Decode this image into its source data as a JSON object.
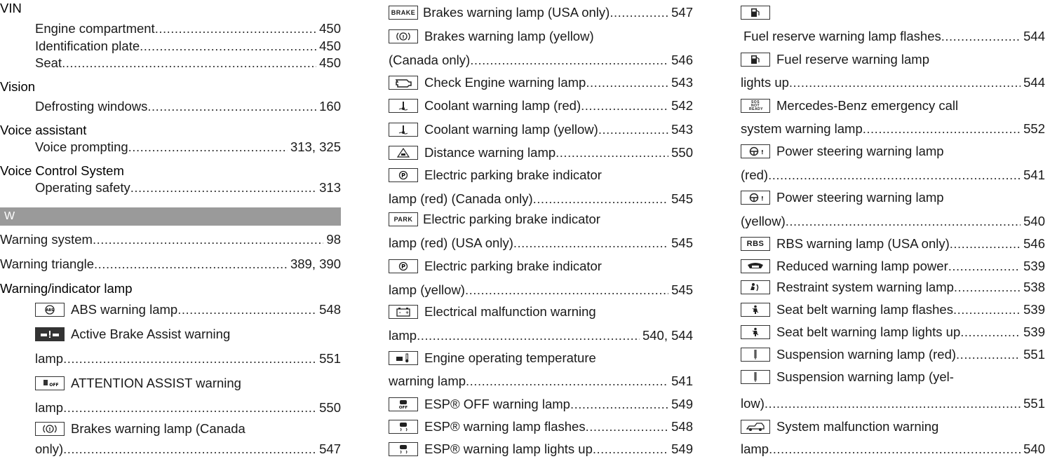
{
  "col1": {
    "vin": "VIN",
    "vin_items": [
      {
        "label": "Engine compartment",
        "page": "450"
      },
      {
        "label": "Identification plate",
        "page": "450"
      },
      {
        "label": "Seat",
        "page": "450"
      }
    ],
    "vision": "Vision",
    "vision_items": [
      {
        "label": "Defrosting windows",
        "page": "160"
      }
    ],
    "voice_assistant": "Voice assistant",
    "voice_assistant_items": [
      {
        "label": "Voice prompting",
        "page": "313, 325"
      }
    ],
    "voice_control": "Voice Control System",
    "voice_control_items": [
      {
        "label": "Operating safety",
        "page": "313"
      }
    ],
    "section_letter": "W",
    "warning_system": {
      "label": "Warning system",
      "page": "98"
    },
    "warning_triangle": {
      "label": "Warning triangle",
      "page": "389, 390"
    },
    "warning_indicator": "Warning/indicator lamp",
    "wi_items": [
      {
        "icon": "abs-icon",
        "label": "ABS warning lamp",
        "page": "548"
      },
      {
        "icon": "active-brake-assist-icon",
        "label": "Active Brake Assist warning",
        "cont": "lamp",
        "page": "551"
      },
      {
        "icon": "attention-assist-icon",
        "label": "ATTENTION ASSIST warning",
        "cont": "lamp",
        "page": "550"
      },
      {
        "icon": "brake-circle-icon",
        "label": "Brakes warning lamp (Canada",
        "cont": "only)",
        "page": "547"
      }
    ]
  },
  "col2": {
    "items": [
      {
        "icon": "brake-text-icon",
        "icon_text": "BRAKE",
        "label": "Brakes warning lamp (USA only)",
        "page": "547"
      },
      {
        "icon": "brake-circle-icon",
        "label": "Brakes warning lamp (yellow)",
        "cont": "(Canada only)",
        "page": "546"
      },
      {
        "icon": "check-engine-icon",
        "label": "Check Engine warning lamp",
        "page": "543"
      },
      {
        "icon": "coolant-icon",
        "label": "Coolant warning lamp (red)",
        "page": "542"
      },
      {
        "icon": "coolant-icon",
        "label": "Coolant warning lamp (yellow)",
        "page": "543"
      },
      {
        "icon": "distance-warning-icon",
        "label": "Distance warning lamp",
        "page": "550"
      },
      {
        "icon": "parking-brake-p-icon",
        "label": "Electric parking brake indicator",
        "cont": "lamp (red) (Canada only)",
        "page": "545"
      },
      {
        "icon": "park-text-icon",
        "icon_text": "PARK",
        "label": "Electric parking brake indicator",
        "cont": "lamp (red) (USA only)",
        "page": "545"
      },
      {
        "icon": "parking-brake-p-icon",
        "label": "Electric parking brake indicator",
        "cont": "lamp (yellow)",
        "page": "545"
      },
      {
        "icon": "battery-icon",
        "label": "Electrical malfunction warning",
        "cont": "lamp",
        "page": "540, 544"
      },
      {
        "icon": "engine-temperature-icon",
        "label": "Engine operating temperature",
        "cont": "warning lamp",
        "page": "541"
      },
      {
        "icon": "esp-off-icon",
        "label": "ESP® OFF warning lamp",
        "page": "549"
      },
      {
        "icon": "esp-icon",
        "label": "ESP® warning lamp flashes",
        "page": "548"
      },
      {
        "icon": "esp-icon",
        "label": "ESP® warning lamp lights up",
        "page": "549"
      }
    ]
  },
  "col3": {
    "items": [
      {
        "icon": "fuel-icon",
        "label": "",
        "cont": "Fuel reserve warning lamp flashes",
        "page": "544",
        "cont_indent": true
      },
      {
        "icon": "fuel-icon",
        "label": "Fuel reserve warning lamp",
        "cont": "lights up",
        "page": "544"
      },
      {
        "icon": "sos-icon",
        "icon_text": "SOS NOT READY",
        "label": "Mercedes-Benz emergency call",
        "cont": "system warning lamp",
        "page": "552"
      },
      {
        "icon": "power-steering-icon",
        "label": "Power steering warning lamp",
        "cont": "(red)",
        "page": "541"
      },
      {
        "icon": "power-steering-icon",
        "label": "Power steering warning lamp",
        "cont": "(yellow)",
        "page": "540"
      },
      {
        "icon": "rbs-text-icon",
        "icon_text": "RBS",
        "label": "RBS warning lamp (USA only)",
        "page": "546"
      },
      {
        "icon": "reduced-power-icon",
        "label": "Reduced warning lamp power",
        "page": "539"
      },
      {
        "icon": "restraint-system-icon",
        "label": "Restraint system warning lamp",
        "page": "538"
      },
      {
        "icon": "seat-belt-icon",
        "label": "Seat belt warning lamp flashes",
        "page": "539"
      },
      {
        "icon": "seat-belt-icon",
        "label": "Seat belt warning lamp lights up",
        "page": "539"
      },
      {
        "icon": "suspension-icon",
        "label": "Suspension warning lamp (red)",
        "page": "551"
      },
      {
        "icon": "suspension-icon",
        "label": "Suspension warning lamp (yel-",
        "cont": "low)",
        "page": "551"
      },
      {
        "icon": "system-malfunction-icon",
        "label": "System malfunction warning",
        "cont": "lamp",
        "page": "540"
      }
    ]
  }
}
